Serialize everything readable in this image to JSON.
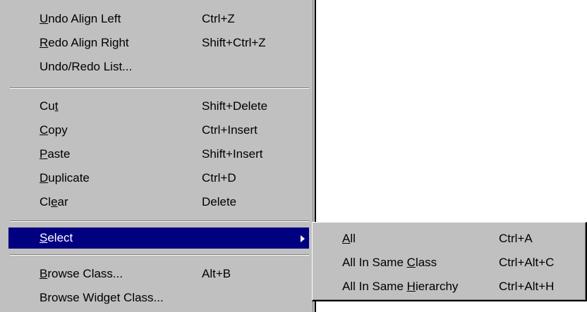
{
  "context_menu": {
    "items": [
      {
        "label_prefix": "",
        "mnemonic": "U",
        "label_suffix": "ndo Align Left",
        "shortcut": "Ctrl+Z"
      },
      {
        "label_prefix": "",
        "mnemonic": "R",
        "label_suffix": "edo Align Right",
        "shortcut": "Shift+Ctrl+Z"
      },
      {
        "label_prefix": "Undo/Redo List...",
        "mnemonic": "",
        "label_suffix": "",
        "shortcut": ""
      },
      {
        "label_prefix": "Cu",
        "mnemonic": "t",
        "label_suffix": "",
        "shortcut": "Shift+Delete"
      },
      {
        "label_prefix": "",
        "mnemonic": "C",
        "label_suffix": "opy",
        "shortcut": "Ctrl+Insert"
      },
      {
        "label_prefix": "",
        "mnemonic": "P",
        "label_suffix": "aste",
        "shortcut": "Shift+Insert"
      },
      {
        "label_prefix": "",
        "mnemonic": "D",
        "label_suffix": "uplicate",
        "shortcut": "Ctrl+D"
      },
      {
        "label_prefix": "Cl",
        "mnemonic": "e",
        "label_suffix": "ar",
        "shortcut": "Delete"
      },
      {
        "label_prefix": "",
        "mnemonic": "S",
        "label_suffix": "elect",
        "shortcut": ""
      },
      {
        "label_prefix": "",
        "mnemonic": "B",
        "label_suffix": "rowse Class...",
        "shortcut": "Alt+B"
      },
      {
        "label_prefix": "Browse Widget Class...",
        "mnemonic": "",
        "label_suffix": "",
        "shortcut": ""
      }
    ]
  },
  "submenu": {
    "items": [
      {
        "label_prefix": "",
        "mnemonic": "A",
        "label_suffix": "ll",
        "shortcut": "Ctrl+A"
      },
      {
        "label_prefix": "All In Same ",
        "mnemonic": "C",
        "label_suffix": "lass",
        "shortcut": "Ctrl+Alt+C"
      },
      {
        "label_prefix": "All In Same ",
        "mnemonic": "H",
        "label_suffix": "ierarchy",
        "shortcut": "Ctrl+Alt+H"
      }
    ]
  },
  "colors": {
    "menu_bg": "#c0c0c0",
    "highlight_bg": "#000080",
    "highlight_fg": "#ffffff"
  }
}
